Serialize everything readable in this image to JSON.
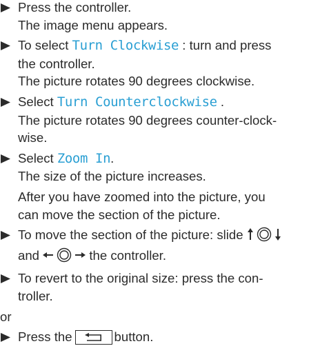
{
  "steps": [
    {
      "lines": [
        "Press the controller.",
        "The image menu appears."
      ]
    },
    {
      "pre": "To select ",
      "cmd": "Turn Clockwise",
      "post": " : turn and press",
      "line2": "the controller.",
      "line3": "The picture rotates 90 degrees clockwise."
    },
    {
      "pre": "Select ",
      "cmd": "Turn Counterclockwise",
      "post": " .",
      "line2": "The picture rotates 90 degrees counter-clock-",
      "line3": "wise."
    },
    {
      "pre": "Select ",
      "cmd": "Zoom In",
      "post": ".",
      "line2": "The size of the picture increases.",
      "line3": "After you have zoomed into the picture, you",
      "line4": "can move the section of the picture."
    },
    {
      "line1": "To move the section of the picture: slide",
      "line2_pre": "and",
      "line2_post": "the controller."
    },
    {
      "line1": "To revert to the original size: press the con-",
      "line2": "troller."
    }
  ],
  "or_text": "or",
  "last_step": {
    "pre": "Press the",
    "post": "button."
  },
  "icons": {
    "bullet": "right-triangle-arrow",
    "controller_updown": "controller-slide-up-down-icon",
    "controller_leftright": "controller-slide-left-right-icon",
    "back_button": "back-arrow-icon"
  },
  "colors": {
    "text": "#2b2b2b",
    "command": "#2a9fd3"
  }
}
